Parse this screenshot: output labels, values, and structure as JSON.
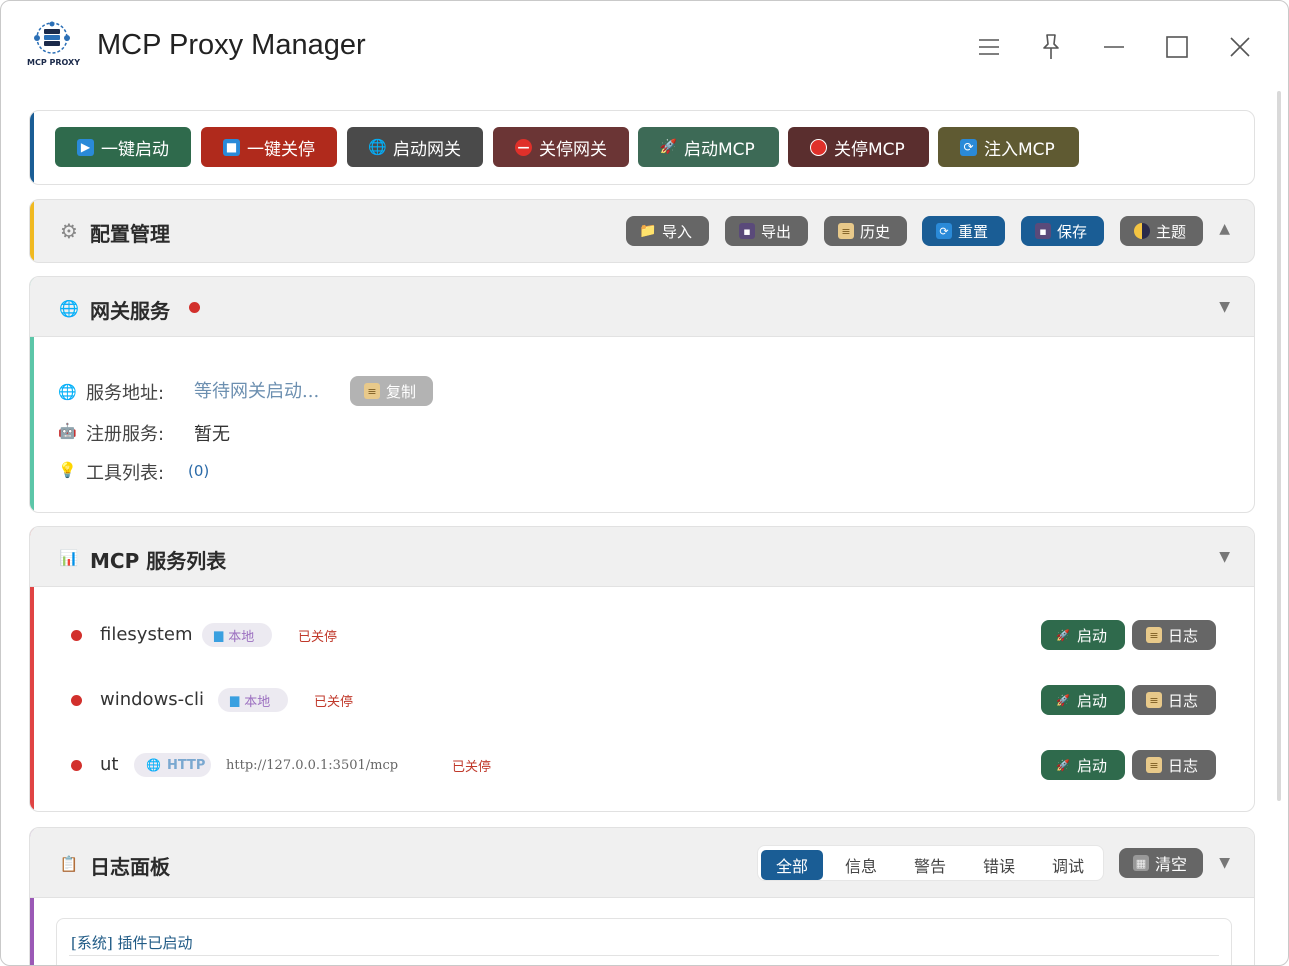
{
  "window": {
    "title": "MCP Proxy Manager",
    "logo_text": "MCP PROXY"
  },
  "toolbar": [
    {
      "label": "一键启动",
      "icon": "play-icon",
      "bg": "#2f6a4c"
    },
    {
      "label": "一键关停",
      "icon": "stop-icon",
      "bg": "#b02a1c"
    },
    {
      "label": "启动网关",
      "icon": "globe-icon",
      "bg": "#4a4a4a"
    },
    {
      "label": "关停网关",
      "icon": "no-entry-icon",
      "bg": "#6b3535"
    },
    {
      "label": "启动MCP",
      "icon": "rocket-icon",
      "bg": "#3d6a56"
    },
    {
      "label": "关停MCP",
      "icon": "red-circle-icon",
      "bg": "#5a2e2e"
    },
    {
      "label": "注入MCP",
      "icon": "refresh-icon",
      "bg": "#5f5a32"
    }
  ],
  "config": {
    "title": "配置管理",
    "buttons": [
      {
        "label": "导入",
        "icon": "folder-icon",
        "bg": "#666666"
      },
      {
        "label": "导出",
        "icon": "floppy-icon",
        "bg": "#666666"
      },
      {
        "label": "历史",
        "icon": "scroll-icon",
        "bg": "#666666"
      },
      {
        "label": "重置",
        "icon": "refresh-icon",
        "bg": "#1a5d95"
      },
      {
        "label": "保存",
        "icon": "floppy-icon",
        "bg": "#1a5d95"
      },
      {
        "label": "主题",
        "icon": "half-moon-icon",
        "bg": "#666666"
      }
    ]
  },
  "gateway": {
    "title": "网关服务",
    "address_label": "服务地址:",
    "address_value": "等待网关启动...",
    "copy_label": "复制",
    "registered_label": "注册服务:",
    "registered_value": "暂无",
    "tools_label": "工具列表:",
    "tools_value": "(0)"
  },
  "mcp": {
    "title": "MCP 服务列表",
    "start_label": "启动",
    "log_label": "日志",
    "items": [
      {
        "name": "filesystem",
        "type": "本地",
        "url": "",
        "status": "已关停"
      },
      {
        "name": "windows-cli",
        "type": "本地",
        "url": "",
        "status": "已关停"
      },
      {
        "name": "ut",
        "type": "HTTP",
        "url": "http://127.0.0.1:3501/mcp",
        "status": "已关停"
      }
    ]
  },
  "logs": {
    "title": "日志面板",
    "filters": [
      "全部",
      "信息",
      "警告",
      "错误",
      "调试"
    ],
    "active_filter": "全部",
    "clear_label": "清空",
    "entries": [
      "[系统] 插件已启动"
    ]
  }
}
